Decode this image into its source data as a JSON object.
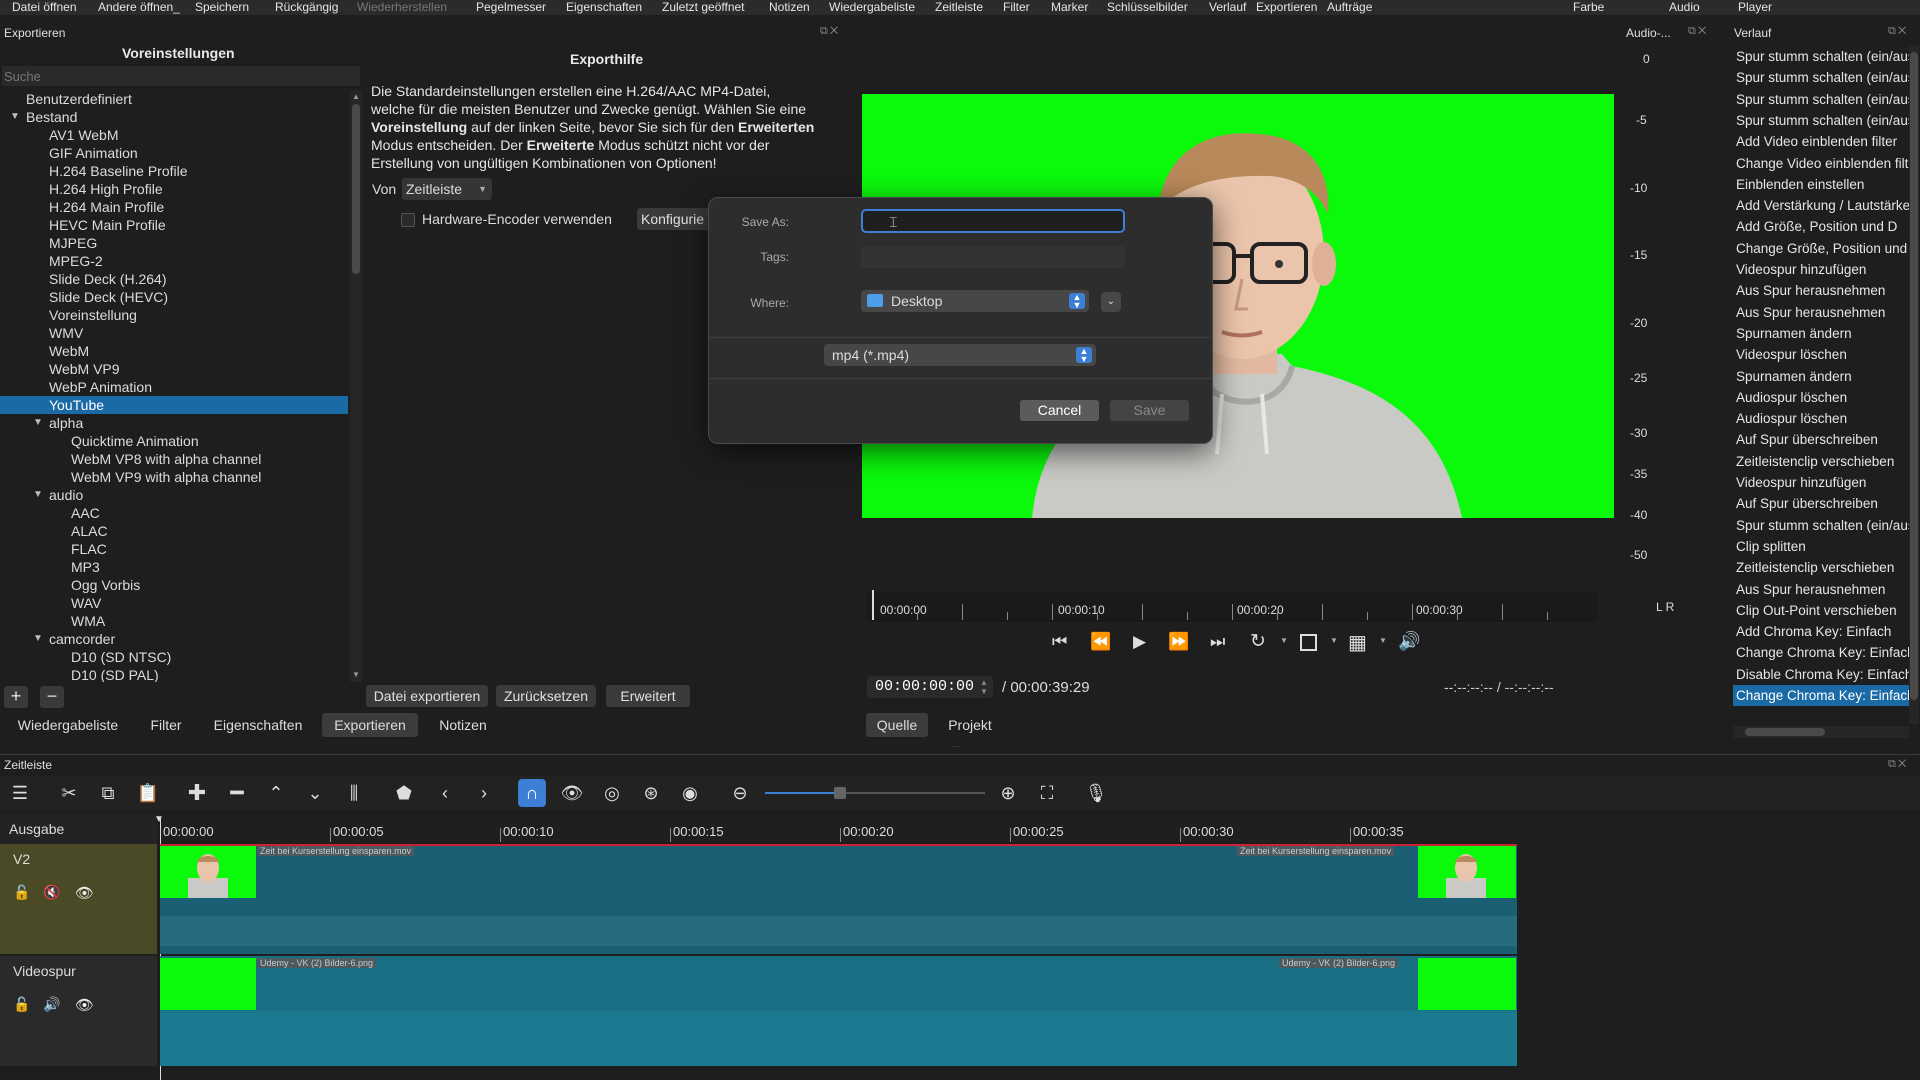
{
  "menubar": {
    "items": [
      "Datei öffnen",
      "Andere öffnen_",
      "Speichern",
      "Rückgängig",
      "Wiederherstellen",
      "Pegelmesser",
      "Eigenschaften",
      "Zuletzt geöffnet",
      "Notizen",
      "Wiedergabeliste",
      "Zeitleiste",
      "Filter",
      "Marker",
      "Schlüsselbilder",
      "Verlauf",
      "Exportieren",
      "Aufträge"
    ],
    "right_items": [
      "Farbe",
      "Audio",
      "Player"
    ]
  },
  "export_panel": {
    "header": "Exportieren",
    "presets_title": "Voreinstellungen",
    "search_placeholder": "Suche",
    "help_title": "Exporthilfe"
  },
  "presets": [
    {
      "label": "Benutzerdefiniert",
      "level": 0,
      "arrow": ""
    },
    {
      "label": "Bestand",
      "level": 0,
      "arrow": "down"
    },
    {
      "label": "AV1 WebM",
      "level": 1,
      "arrow": ""
    },
    {
      "label": "GIF Animation",
      "level": 1,
      "arrow": ""
    },
    {
      "label": "H.264 Baseline Profile",
      "level": 1,
      "arrow": ""
    },
    {
      "label": "H.264 High Profile",
      "level": 1,
      "arrow": ""
    },
    {
      "label": "H.264 Main Profile",
      "level": 1,
      "arrow": ""
    },
    {
      "label": "HEVC Main Profile",
      "level": 1,
      "arrow": ""
    },
    {
      "label": "MJPEG",
      "level": 1,
      "arrow": ""
    },
    {
      "label": "MPEG-2",
      "level": 1,
      "arrow": ""
    },
    {
      "label": "Slide Deck (H.264)",
      "level": 1,
      "arrow": ""
    },
    {
      "label": "Slide Deck (HEVC)",
      "level": 1,
      "arrow": ""
    },
    {
      "label": "Voreinstellung",
      "level": 1,
      "arrow": ""
    },
    {
      "label": "WMV",
      "level": 1,
      "arrow": ""
    },
    {
      "label": "WebM",
      "level": 1,
      "arrow": ""
    },
    {
      "label": "WebM VP9",
      "level": 1,
      "arrow": ""
    },
    {
      "label": "WebP Animation",
      "level": 1,
      "arrow": ""
    },
    {
      "label": "YouTube",
      "level": 1,
      "arrow": "",
      "selected": true
    },
    {
      "label": "alpha",
      "level": 1,
      "arrow": "down"
    },
    {
      "label": "Quicktime Animation",
      "level": 2,
      "arrow": ""
    },
    {
      "label": "WebM VP8 with alpha channel",
      "level": 2,
      "arrow": ""
    },
    {
      "label": "WebM VP9 with alpha channel",
      "level": 2,
      "arrow": ""
    },
    {
      "label": "audio",
      "level": 1,
      "arrow": "down"
    },
    {
      "label": "AAC",
      "level": 2,
      "arrow": ""
    },
    {
      "label": "ALAC",
      "level": 2,
      "arrow": ""
    },
    {
      "label": "FLAC",
      "level": 2,
      "arrow": ""
    },
    {
      "label": "MP3",
      "level": 2,
      "arrow": ""
    },
    {
      "label": "Ogg Vorbis",
      "level": 2,
      "arrow": ""
    },
    {
      "label": "WAV",
      "level": 2,
      "arrow": ""
    },
    {
      "label": "WMA",
      "level": 2,
      "arrow": ""
    },
    {
      "label": "camcorder",
      "level": 1,
      "arrow": "down"
    },
    {
      "label": "D10 (SD NTSC)",
      "level": 2,
      "arrow": ""
    },
    {
      "label": "D10 (SD PAL)",
      "level": 2,
      "arrow": ""
    }
  ],
  "help": {
    "line1": "Die Standardeinstellungen erstellen eine H.264/AAC MP4-Datei,",
    "line2": "welche für die meisten Benutzer und Zwecke genügt. Wählen Sie eine",
    "l3_bold1": "Voreinstellung",
    "l3_mid": " auf der linken Seite, bevor Sie sich für den ",
    "l3_bold2": "Erweiterten",
    "line4a": "Modus entscheiden. Der ",
    "line4_bold": "Erweiterte",
    "line4b": " Modus schützt nicht vor der",
    "line5": "Erstellung von ungültigen Kombinationen von Optionen!"
  },
  "from": {
    "label": "Von",
    "value": "Zeitleiste"
  },
  "hw_encoder": {
    "label": "Hardware-Encoder verwenden",
    "configure": "Konfigurie"
  },
  "export_buttons": {
    "export_file": "Datei exportieren",
    "reset": "Zurücksetzen",
    "advanced": "Erweitert"
  },
  "bottom_tabs": [
    "Wiedergabeliste",
    "Filter",
    "Eigenschaften",
    "Exportieren",
    "Notizen"
  ],
  "save_dialog": {
    "save_as_label": "Save As:",
    "save_as_value": "",
    "tags_label": "Tags:",
    "where_label": "Where:",
    "where_value": "Desktop",
    "format_value": "mp4 (*.mp4)",
    "cancel": "Cancel",
    "save": "Save"
  },
  "player": {
    "ruler_labels": [
      "00:00:00",
      "00:00:10",
      "00:00:20",
      "00:00:30"
    ],
    "timecode": "00:00:00:00",
    "duration": "/ 00:00:39:29",
    "in_out": "--:--:--:-- / --:--:--:--",
    "tabs": [
      "Quelle",
      "Projekt"
    ]
  },
  "audio_meter": {
    "header": "Audio-...",
    "scale": [
      "0",
      "-5",
      "-10",
      "-15",
      "-20",
      "-25",
      "-30",
      "-35",
      "-40",
      "-50"
    ],
    "channels": "L  R"
  },
  "history": {
    "header": "Verlauf",
    "items": [
      "Spur stumm schalten (ein/aus)",
      "Spur stumm schalten (ein/aus)",
      "Spur stumm schalten (ein/aus)",
      "Spur stumm schalten (ein/aus)",
      "Add Video einblenden filter",
      "Change Video einblenden filter",
      "Einblenden einstellen",
      "Add Verstärkung / Lautstärke",
      "Add Größe, Position und D",
      "Change Größe, Position und",
      "Videospur hinzufügen",
      "Aus Spur herausnehmen",
      "Aus Spur herausnehmen",
      "Spurnamen ändern",
      "Videospur löschen",
      "Spurnamen ändern",
      "Audiospur löschen",
      "Audiospur löschen",
      "Auf Spur überschreiben",
      "Zeitleistenclip verschieben",
      "Videospur hinzufügen",
      "Auf Spur überschreiben",
      "Spur stumm schalten (ein/aus)",
      "Clip splitten",
      "Zeitleistenclip verschieben",
      "Aus Spur herausnehmen",
      "Clip Out-Point verschieben",
      "Add Chroma Key: Einfach",
      "Change Chroma Key: Einfach",
      "Disable Chroma Key: Einfach",
      "Change Chroma Key: Einfach"
    ],
    "selected_index": 30
  },
  "timeline": {
    "header": "Zeitleiste",
    "output_label": "Ausgabe",
    "ruler_labels": [
      "00:00:00",
      "00:00:05",
      "00:00:10",
      "00:00:15",
      "00:00:20",
      "00:00:25",
      "00:00:30",
      "00:00:35"
    ],
    "tracks": [
      {
        "name": "V2",
        "clip_left": "Zeit bei Kurserstellung einsparen.mov",
        "clip_right": "Zeit bei Kurserstellung einsparen.mov"
      },
      {
        "name": "Videospur",
        "clip_left": "Udemy - VK (2) Bilder-6.png",
        "clip_right": "Udemy - VK (2) Bilder-6.png"
      }
    ]
  },
  "colors": {
    "accent": "#1a6aa5",
    "green_screen": "#0bf90b",
    "track_clip": "#1a6f84",
    "playhead_red": "#cc2222"
  }
}
